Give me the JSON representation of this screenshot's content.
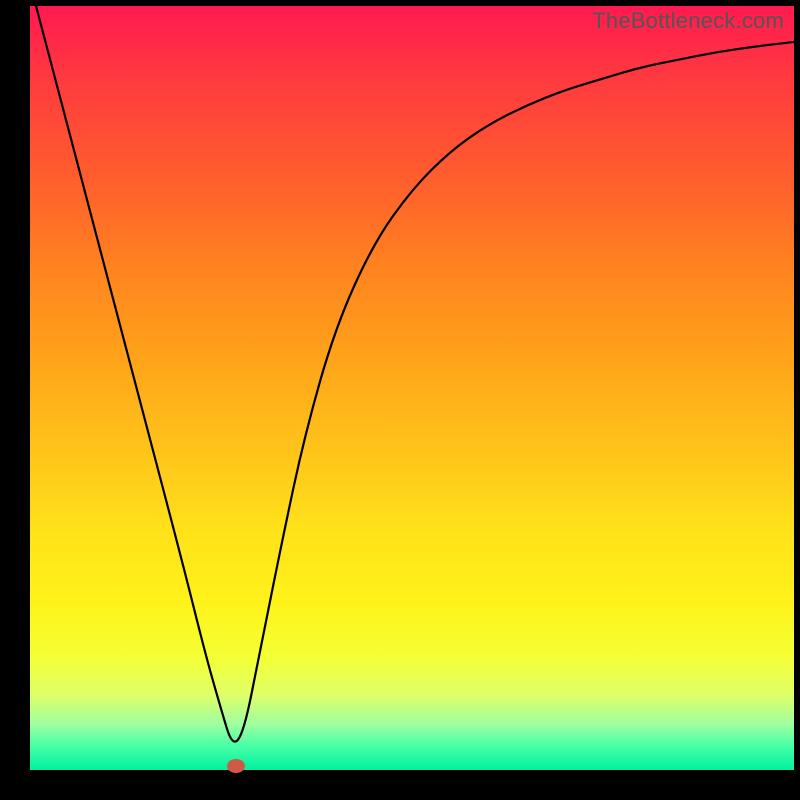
{
  "watermark": "TheBottleneck.com",
  "colors": {
    "gradient_top": "#ff1a50",
    "gradient_bottom": "#00f0a0",
    "curve": "#000000",
    "marker": "#d05a4a",
    "frame": "#000000"
  },
  "chart_data": {
    "type": "line",
    "title": "",
    "xlabel": "",
    "ylabel": "",
    "xlim": [
      0,
      100
    ],
    "ylim": [
      0,
      100
    ],
    "series": [
      {
        "name": "bottleneck-curve",
        "x": [
          0,
          5,
          10,
          15,
          20,
          23,
          25,
          26.5,
          28,
          30,
          33,
          36,
          40,
          45,
          50,
          55,
          60,
          65,
          70,
          75,
          80,
          85,
          90,
          95,
          100
        ],
        "y": [
          103,
          84,
          65,
          46,
          27,
          15,
          8,
          3,
          5,
          15,
          30,
          44,
          58,
          69,
          76,
          81,
          84.5,
          87,
          89,
          90.5,
          92,
          93,
          94,
          94.7,
          95.3
        ]
      }
    ],
    "marker": {
      "x": 27,
      "y": 0.5
    },
    "annotations": []
  }
}
